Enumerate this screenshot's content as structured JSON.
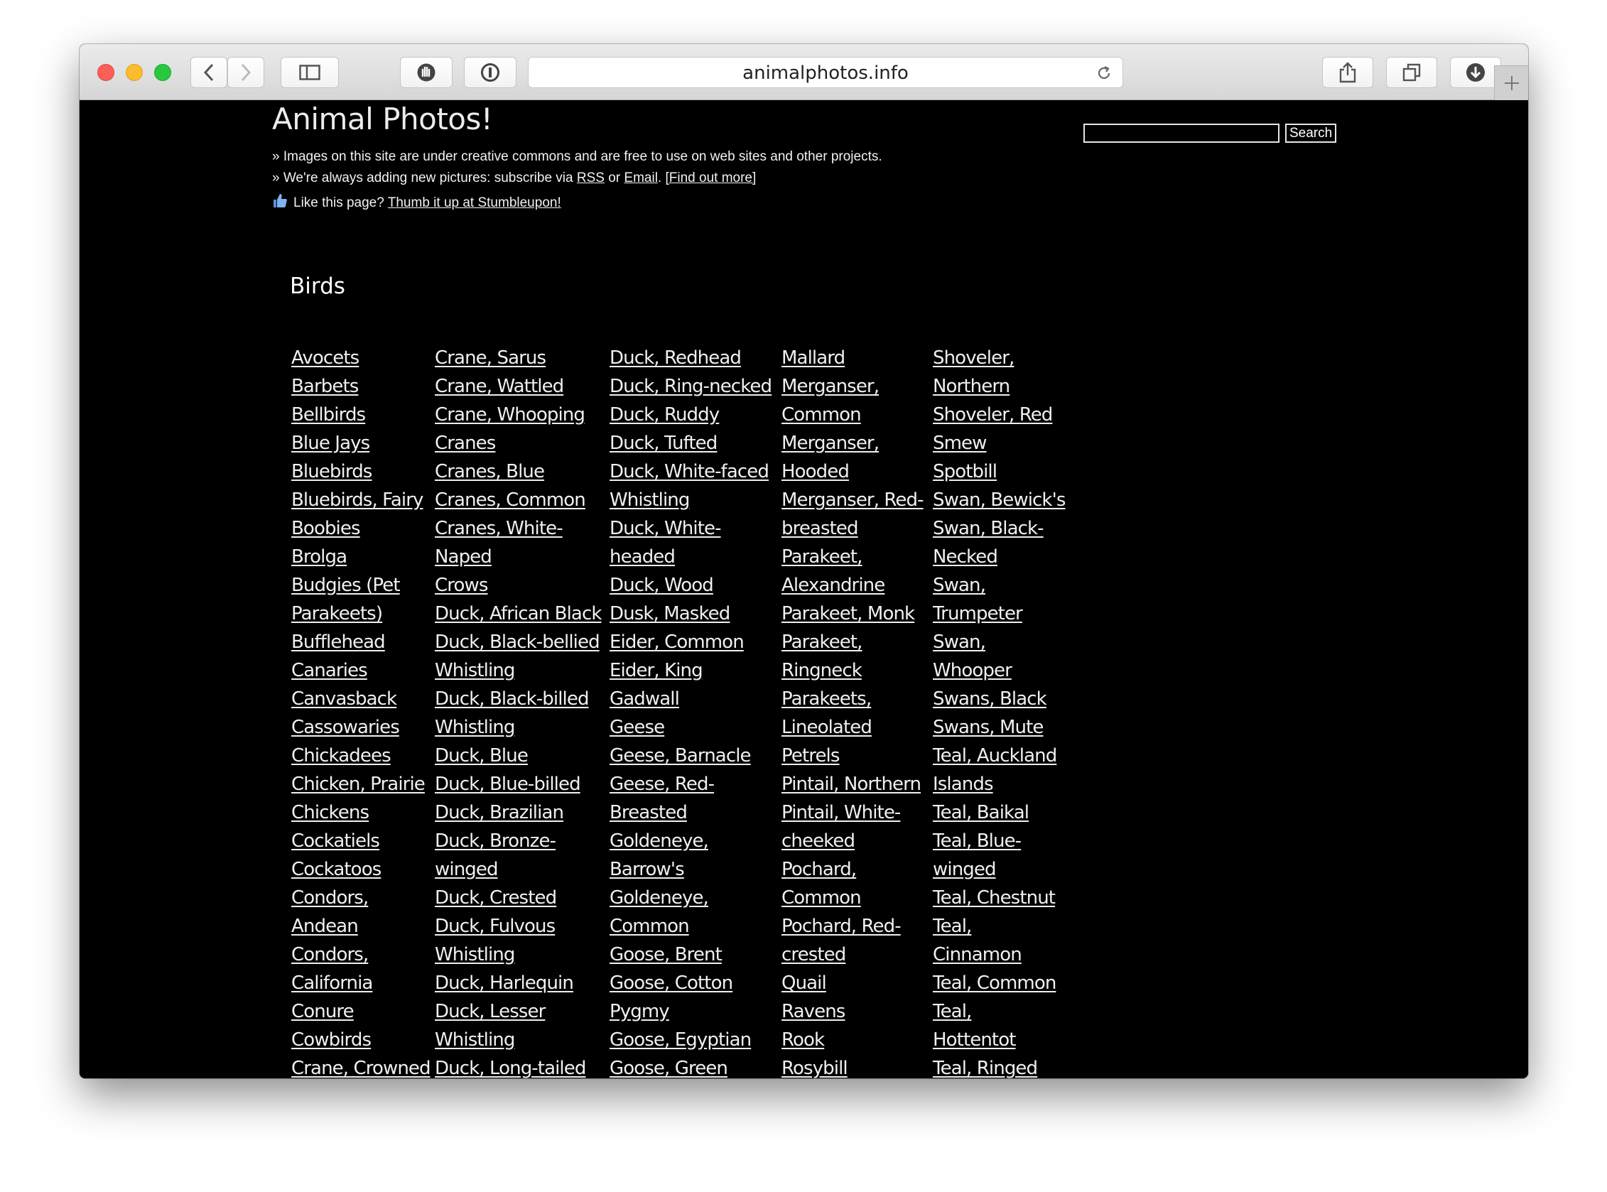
{
  "browser": {
    "url": "animalphotos.info"
  },
  "site": {
    "title": "Animal Photos!",
    "line1": "» Images on this site are under creative commons and are free to use on web sites and other projects.",
    "line2_prefix": "» We're always adding new pictures: subscribe via ",
    "line2_rss": "RSS",
    "line2_or": " or ",
    "line2_email": "Email",
    "line2_sep": ". ",
    "line2_more": "[Find out more]",
    "line3_prefix": "Like this page? ",
    "line3_link": "Thumb it up at Stumbleupon!"
  },
  "search": {
    "value": "",
    "button": "Search"
  },
  "birds": {
    "heading": "Birds",
    "columns": [
      [
        "Avocets",
        "Barbets",
        "Bellbirds",
        "Blue Jays",
        "Bluebirds",
        "Bluebirds, Fairy",
        "Boobies",
        "Brolga",
        "Budgies (Pet",
        "Parakeets)",
        "Bufflehead",
        "Canaries",
        "Canvasback",
        "Cassowaries",
        "Chickadees",
        "Chicken, Prairie",
        "Chickens",
        "Cockatiels",
        "Cockatoos",
        "Condors,",
        "Andean",
        "Condors,",
        "California",
        "Conure",
        "Cowbirds",
        "Crane, Crowned"
      ],
      [
        "Crane, Sarus",
        "Crane, Wattled",
        "Crane, Whooping",
        "Cranes",
        "Cranes, Blue",
        "Cranes, Common",
        "Cranes, White-",
        "Naped",
        "Crows",
        "Duck, African Black",
        "Duck, Black-bellied",
        "Whistling",
        "Duck, Black-billed",
        "Whistling",
        "Duck, Blue",
        "Duck, Blue-billed",
        "Duck, Brazilian",
        "Duck, Bronze-",
        "winged",
        "Duck, Crested",
        "Duck, Fulvous",
        "Whistling",
        "Duck, Harlequin",
        "Duck, Lesser",
        "Whistling",
        "Duck, Long-tailed"
      ],
      [
        "Duck, Redhead",
        "Duck, Ring-necked",
        "Duck, Ruddy",
        "Duck, Tufted",
        "Duck, White-faced",
        "Whistling",
        "Duck, White-",
        "headed",
        "Duck, Wood",
        "Dusk, Masked",
        "Eider, Common",
        "Eider, King",
        "Gadwall",
        "Geese",
        "Geese, Barnacle",
        "Geese, Red-",
        "Breasted",
        "Goldeneye,",
        "Barrow's",
        "Goldeneye,",
        "Common",
        "Goose, Brent",
        "Goose, Cotton",
        "Pygmy",
        "Goose, Egyptian",
        "Goose, Green"
      ],
      [
        "Mallard",
        "Merganser,",
        "Common",
        "Merganser,",
        "Hooded",
        "Merganser, Red-",
        "breasted",
        "Parakeet,",
        "Alexandrine",
        "Parakeet, Monk",
        "Parakeet,",
        "Ringneck",
        "Parakeets,",
        "Lineolated",
        "Petrels",
        "Pintail, Northern",
        "Pintail, White-",
        "cheeked",
        "Pochard,",
        "Common",
        "Pochard, Red-",
        "crested",
        "Quail",
        "Ravens",
        "Rook",
        "Rosybill"
      ],
      [
        "Shoveler,",
        "Northern",
        "Shoveler, Red",
        "Smew",
        "Spotbill",
        "Swan, Bewick's",
        "Swan, Black-",
        "Necked",
        "Swan,",
        "Trumpeter",
        "Swan,",
        "Whooper",
        "Swans, Black",
        "Swans, Mute",
        "Teal, Auckland",
        "Islands",
        "Teal, Baikal",
        "Teal, Blue-",
        "winged",
        "Teal, Chestnut",
        "Teal,",
        "Cinnamon",
        "Teal, Common",
        "Teal,",
        "Hottentot",
        "Teal, Ringed"
      ]
    ]
  }
}
